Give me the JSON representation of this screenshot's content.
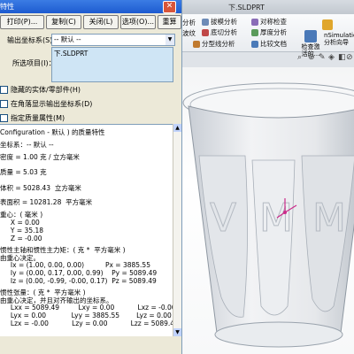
{
  "background_app": {
    "title": "下.SLDPRT",
    "ribbon": {
      "items": [
        {
          "name": "ribbon-draft-analysis",
          "label": "拔模分析",
          "icon_color": "#6d8bb7"
        },
        {
          "name": "ribbon-symmetry-check",
          "label": "对称检查",
          "icon_color": "#8a6db7"
        },
        {
          "name": "ribbon-undercut-analysis",
          "label": "底切分析",
          "icon_color": "#c04848"
        },
        {
          "name": "ribbon-thickness-analysis",
          "label": "厚度分析",
          "icon_color": "#5a9a5a"
        },
        {
          "name": "ribbon-parting-line-analysis",
          "label": "分型线分析",
          "icon_color": "#c07a30"
        },
        {
          "name": "ribbon-compare-documents",
          "label": "比较文档",
          "icon_color": "#4a7ab8"
        }
      ],
      "left_fragments": [
        "分析",
        "波纹"
      ],
      "inspect_label": "检查激活的...",
      "simulation_label": "nSimulation(x)\n分析向导"
    },
    "view_toolbar_icons": [
      "search-icon",
      "zoom-icon",
      "sketch-icon",
      "view-orientation-icon",
      "display-style-icon",
      "section-view-icon",
      "hide-show-icon"
    ]
  },
  "dialog": {
    "title": "特性",
    "buttons": {
      "print": "打印(P)...",
      "copy": "复制(C)",
      "close": "关闭(L)",
      "options": "选项(O)...",
      "recalc": "重算(R)"
    },
    "output_coord_label": "输出坐标系(S)：",
    "output_coord_value": "-- 默认 --",
    "selected_items_label": "所选项目(I)：",
    "selected_items": [
      "下.SLDPRT"
    ],
    "checkboxes": [
      {
        "label": "隐藏的实体/零部件(H)",
        "checked": false
      },
      {
        "label": "在角落显示输出坐标系(D)",
        "checked": false
      },
      {
        "label": "指定质量属性(M)",
        "checked": false
      }
    ],
    "results": [
      "Configuration - 默认 ) 的质量特性",
      "",
      "坐标系：-- 默认 --",
      "",
      "密度 = 1.00 克 / 立方毫米",
      "",
      "质量 = 5.03 克",
      "",
      "体积 = 5028.43  立方毫米",
      "",
      "表面积 = 10281.28  平方毫米",
      "",
      "重心：( 毫米 )",
      "     X = 0.00",
      "     Y = 35.18",
      "     Z = -0.00",
      "",
      "惯性主轴和惯性主力矩：( 克 *  平方毫米 )",
      "由重心决定。",
      "     Ix = (1.00, 0.00, 0.00)          Px = 3885.55",
      "     Iy = (0.00, 0.17, 0.00, 0.99)    Py = 5089.49",
      "     Iz = (0.00, -0.99, -0.00, 0.17)  Pz = 5089.49",
      "",
      "惯性张量：( 克 *  平方毫米 )",
      "由重心决定，并且对齐输出的坐标系。",
      "     Lxx = 5089.49         Lxy = 0.00           Lxz = -0.00",
      "     Lyx = 0.00            Lyy = 3885.55        Lyz = 0.00",
      "     Lzx = -0.00           Lzy = 0.00           Lzz = 5089.49"
    ]
  }
}
